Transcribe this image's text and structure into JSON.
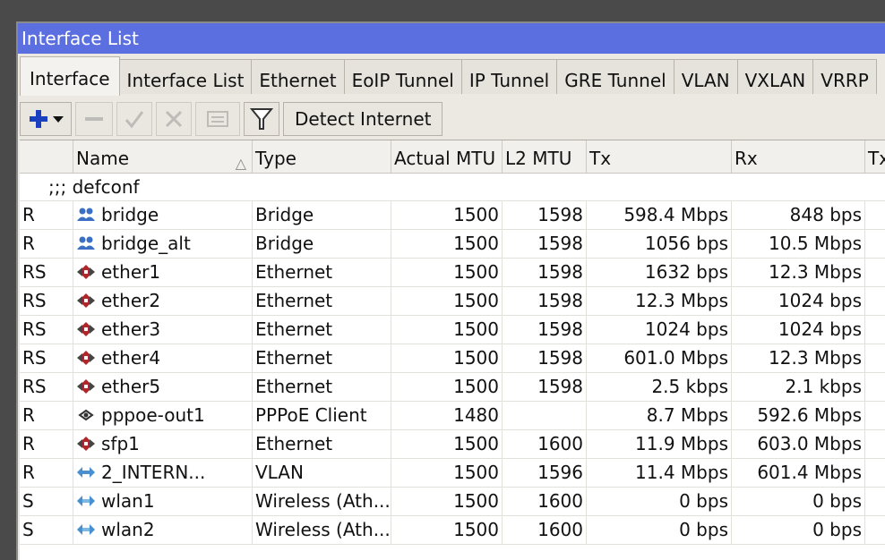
{
  "window": {
    "title": "Interface List"
  },
  "tabs": [
    "Interface",
    "Interface List",
    "Ethernet",
    "EoIP Tunnel",
    "IP Tunnel",
    "GRE Tunnel",
    "VLAN",
    "VXLAN",
    "VRRP"
  ],
  "toolbar": {
    "detect_label": "Detect Internet",
    "icons": [
      "add-icon",
      "remove-icon",
      "enable-icon",
      "disable-icon",
      "comment-icon",
      "filter-icon"
    ]
  },
  "table": {
    "headers": [
      "",
      "Name",
      "Type",
      "Actual MTU",
      "L2 MTU",
      "Tx",
      "Rx",
      "Tx"
    ],
    "sort_indicator": "△",
    "comment": ";;; defconf",
    "rows": [
      {
        "flags": "R",
        "icon": "bridge-icon",
        "name": "bridge",
        "type": "Bridge",
        "mtu": "1500",
        "l2mtu": "1598",
        "tx": "598.4 Mbps",
        "rx": "848 bps"
      },
      {
        "flags": "R",
        "icon": "bridge-icon",
        "name": "bridge_alt",
        "type": "Bridge",
        "mtu": "1500",
        "l2mtu": "1598",
        "tx": "1056 bps",
        "rx": "10.5 Mbps"
      },
      {
        "flags": "RS",
        "icon": "ethernet-icon",
        "name": "ether1",
        "type": "Ethernet",
        "mtu": "1500",
        "l2mtu": "1598",
        "tx": "1632 bps",
        "rx": "12.3 Mbps"
      },
      {
        "flags": "RS",
        "icon": "ethernet-icon",
        "name": "ether2",
        "type": "Ethernet",
        "mtu": "1500",
        "l2mtu": "1598",
        "tx": "12.3 Mbps",
        "rx": "1024 bps"
      },
      {
        "flags": "RS",
        "icon": "ethernet-icon",
        "name": "ether3",
        "type": "Ethernet",
        "mtu": "1500",
        "l2mtu": "1598",
        "tx": "1024 bps",
        "rx": "1024 bps"
      },
      {
        "flags": "RS",
        "icon": "ethernet-icon",
        "name": "ether4",
        "type": "Ethernet",
        "mtu": "1500",
        "l2mtu": "1598",
        "tx": "601.0 Mbps",
        "rx": "12.3 Mbps"
      },
      {
        "flags": "RS",
        "icon": "ethernet-icon",
        "name": "ether5",
        "type": "Ethernet",
        "mtu": "1500",
        "l2mtu": "1598",
        "tx": "2.5 kbps",
        "rx": "2.1 kbps"
      },
      {
        "flags": "R",
        "icon": "pppoe-icon",
        "name": "pppoe-out1",
        "type": "PPPoE Client",
        "mtu": "1480",
        "l2mtu": "",
        "tx": "8.7 Mbps",
        "rx": "592.6 Mbps"
      },
      {
        "flags": "R",
        "icon": "ethernet-icon",
        "name": "sfp1",
        "type": "Ethernet",
        "mtu": "1500",
        "l2mtu": "1600",
        "tx": "11.9 Mbps",
        "rx": "603.0 Mbps"
      },
      {
        "flags": "R",
        "icon": "vlan-icon",
        "name": "2_INTERN...",
        "type": "VLAN",
        "mtu": "1500",
        "l2mtu": "1596",
        "tx": "11.4 Mbps",
        "rx": "601.4 Mbps",
        "indent": true
      },
      {
        "flags": "S",
        "icon": "wireless-icon",
        "name": "wlan1",
        "type": "Wireless (Ath...",
        "mtu": "1500",
        "l2mtu": "1600",
        "tx": "0 bps",
        "rx": "0 bps"
      },
      {
        "flags": "S",
        "icon": "wireless-icon",
        "name": "wlan2",
        "type": "Wireless (Ath...",
        "mtu": "1500",
        "l2mtu": "1600",
        "tx": "0 bps",
        "rx": "0 bps"
      }
    ]
  },
  "colors": {
    "titlebar": "#5b6fe0",
    "add_icon": "#1a3fbf",
    "ethernet_icon": "#b0242c",
    "bridge_icon": "#3a6fc4",
    "wireless_icon": "#4a90d0"
  }
}
